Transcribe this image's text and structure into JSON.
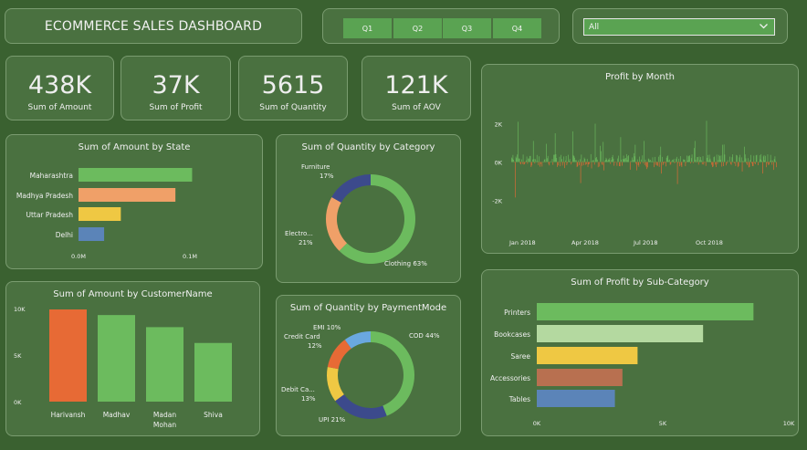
{
  "header": {
    "title": "ECOMMERCE SALES DASHBOARD"
  },
  "quarters": [
    "Q1",
    "Q2",
    "Q3",
    "Q4"
  ],
  "filter": {
    "selected": "All"
  },
  "kpis": [
    {
      "value": "438K",
      "label": "Sum of Amount"
    },
    {
      "value": "37K",
      "label": "Sum of Profit"
    },
    {
      "value": "5615",
      "label": "Sum of Quantity"
    },
    {
      "value": "121K",
      "label": "Sum of AOV"
    }
  ],
  "colors": {
    "background": "#3a6130",
    "panel": "#4a7140",
    "green": "#6cbb5e",
    "orange": "#e76a35",
    "salmon": "#f0a068",
    "yellow": "#efc843",
    "blue": "#5b84b8",
    "navy": "#3c4a8c",
    "lightgreen": "#b4d9a0",
    "brown": "#b87050"
  },
  "chart_data": [
    {
      "type": "bar",
      "orientation": "horizontal",
      "title": "Sum of Amount by State",
      "categories": [
        "Maharashtra",
        "Madhya Pradesh",
        "Uttar Pradesh",
        "Delhi"
      ],
      "values": [
        0.102,
        0.087,
        0.038,
        0.023
      ],
      "xticks": [
        "0.0M",
        "0.1M"
      ],
      "xlim": [
        0,
        0.1
      ],
      "colors": [
        "#6cbb5e",
        "#f0a068",
        "#efc843",
        "#5b84b8"
      ]
    },
    {
      "type": "pie",
      "donut": true,
      "title": "Sum of Quantity by Category",
      "labels": [
        "Clothing",
        "Electro...",
        "Furniture"
      ],
      "percent_labels": [
        "63%",
        "21%",
        "17%"
      ],
      "values": [
        63,
        21,
        17
      ],
      "colors": [
        "#6cbb5e",
        "#f0a068",
        "#3c4a8c"
      ]
    },
    {
      "type": "bar",
      "title": "Profit by Month",
      "yticks": [
        "2K",
        "0K",
        "-2K"
      ],
      "ylim": [
        -2500,
        2500
      ],
      "xticks": [
        "Jan 2018",
        "Apr 2018",
        "Jul 2018",
        "Oct 2018"
      ],
      "positive_color": "#6cbb5e",
      "negative_color": "#e76a35",
      "note_values_count": 365
    },
    {
      "type": "bar",
      "title": "Sum of Amount by CustomerName",
      "categories": [
        "Harivansh",
        "Madhav",
        "Madan Mohan",
        "Shiva"
      ],
      "values": [
        9900,
        9300,
        8000,
        6300
      ],
      "yticks": [
        "10K",
        "5K",
        "0K"
      ],
      "ylim": [
        0,
        10000
      ],
      "colors": [
        "#e76a35",
        "#6cbb5e",
        "#6cbb5e",
        "#6cbb5e"
      ]
    },
    {
      "type": "pie",
      "donut": true,
      "title": "Sum of Quantity by PaymentMode",
      "labels": [
        "COD",
        "UPI",
        "Debit Ca...",
        "Credit Card",
        "EMI"
      ],
      "percent_labels": [
        "44%",
        "21%",
        "13%",
        "12%",
        "10%"
      ],
      "values": [
        44,
        21,
        13,
        12,
        10
      ],
      "colors": [
        "#6cbb5e",
        "#3c4a8c",
        "#efc843",
        "#e76a35",
        "#6aa8e0"
      ]
    },
    {
      "type": "bar",
      "orientation": "horizontal",
      "title": "Sum of Profit by Sub-Category",
      "categories": [
        "Printers",
        "Bookcases",
        "Saree",
        "Accessories",
        "Tables"
      ],
      "values": [
        8600,
        6600,
        4000,
        3400,
        3100
      ],
      "xticks": [
        "0K",
        "5K",
        "10K"
      ],
      "xlim": [
        0,
        10000
      ],
      "colors": [
        "#6cbb5e",
        "#b4d9a0",
        "#efc843",
        "#b87050",
        "#5b84b8"
      ]
    }
  ]
}
